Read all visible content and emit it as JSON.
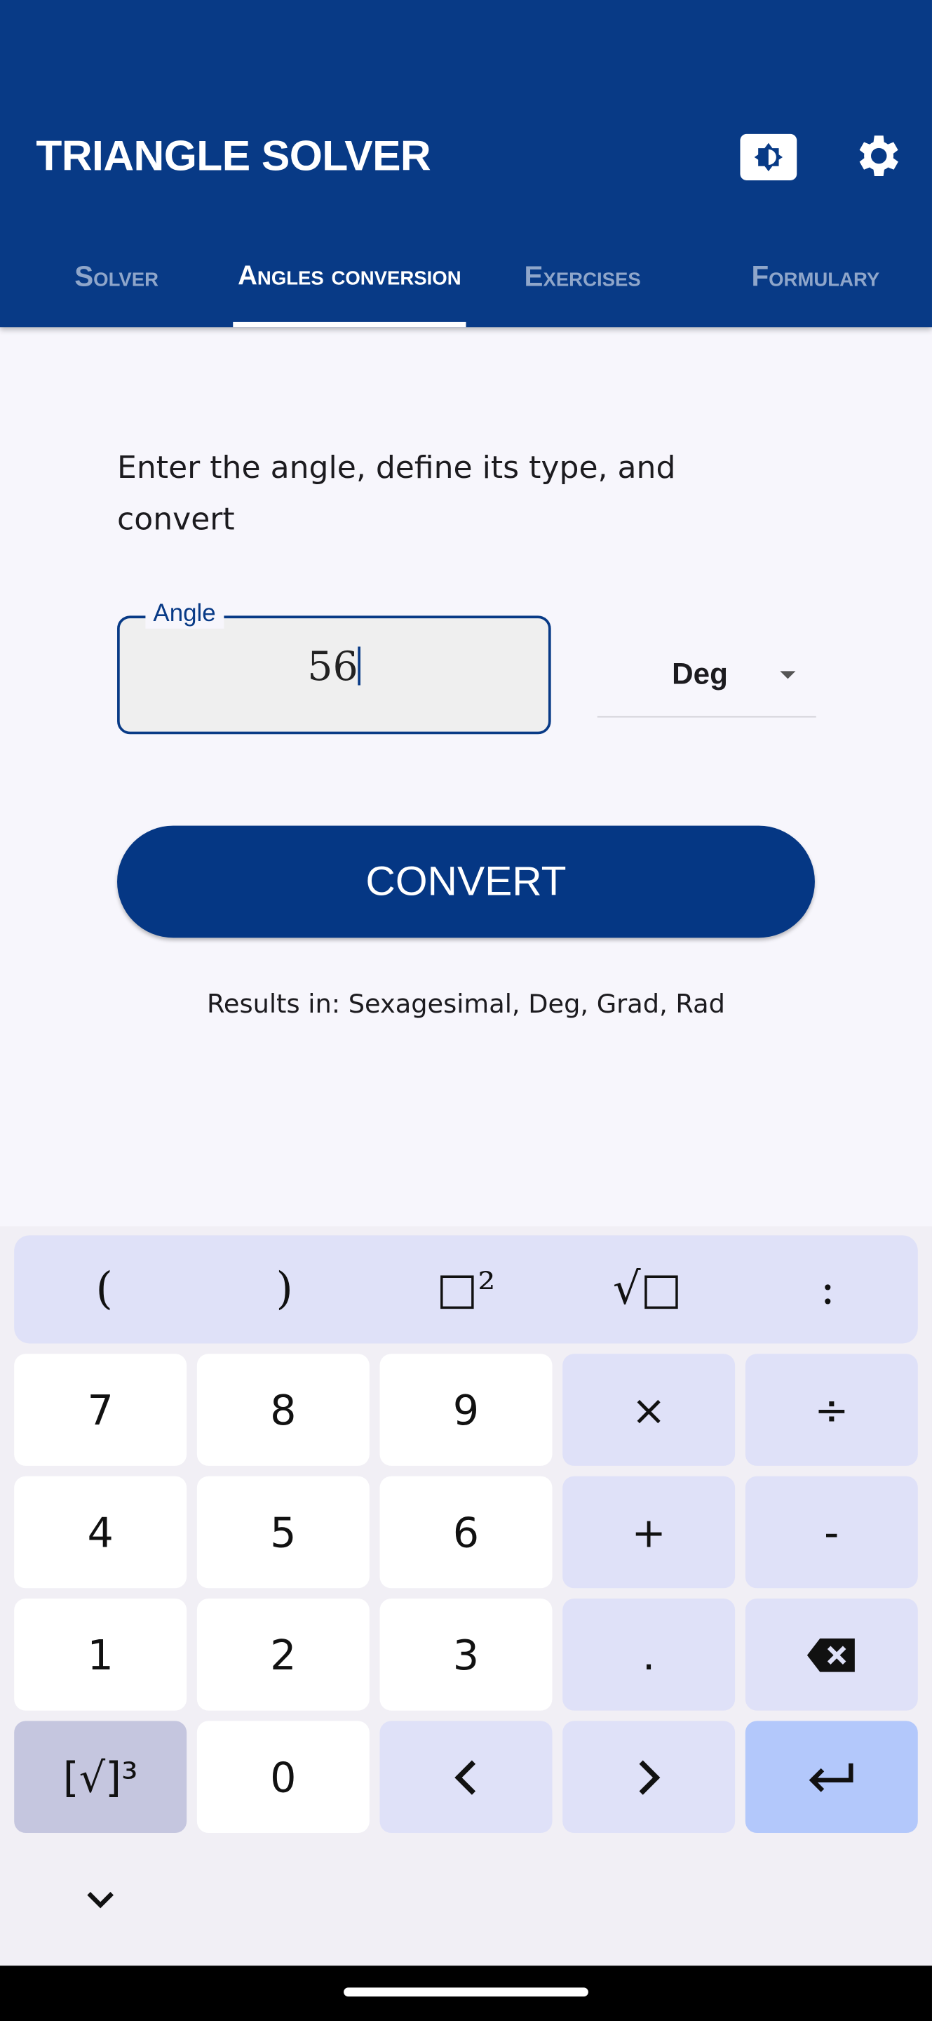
{
  "app": {
    "title": "TRIANGLE SOLVER",
    "brand_color": "#083a86",
    "icons": [
      "brightness-icon",
      "gear-icon"
    ]
  },
  "tabs": [
    {
      "label": "Solver",
      "active": false
    },
    {
      "label": "Angles conversion",
      "active": true
    },
    {
      "label": "Exercises",
      "active": false
    },
    {
      "label": "Formulary",
      "active": false
    }
  ],
  "main": {
    "instructions": "Enter the angle, define its type, and convert",
    "angle_field": {
      "label": "Angle",
      "value": "56"
    },
    "unit_select": {
      "value": "Deg"
    },
    "convert_label": "CONVERT",
    "results_note": "Results in: Sexagesimal, Deg, Grad, Rad"
  },
  "keyboard": {
    "top_row": [
      "(",
      ")",
      "□²",
      "√□",
      ":"
    ],
    "rows": [
      [
        "7",
        "8",
        "9",
        "×",
        "÷"
      ],
      [
        "4",
        "5",
        "6",
        "+",
        "-"
      ],
      [
        "1",
        "2",
        "3",
        ".",
        "backspace-icon"
      ],
      [
        "[√]³",
        "0",
        "left-arrow-icon",
        "right-arrow-icon",
        "enter-icon"
      ]
    ],
    "hide_icon": "chevron-down-icon"
  }
}
